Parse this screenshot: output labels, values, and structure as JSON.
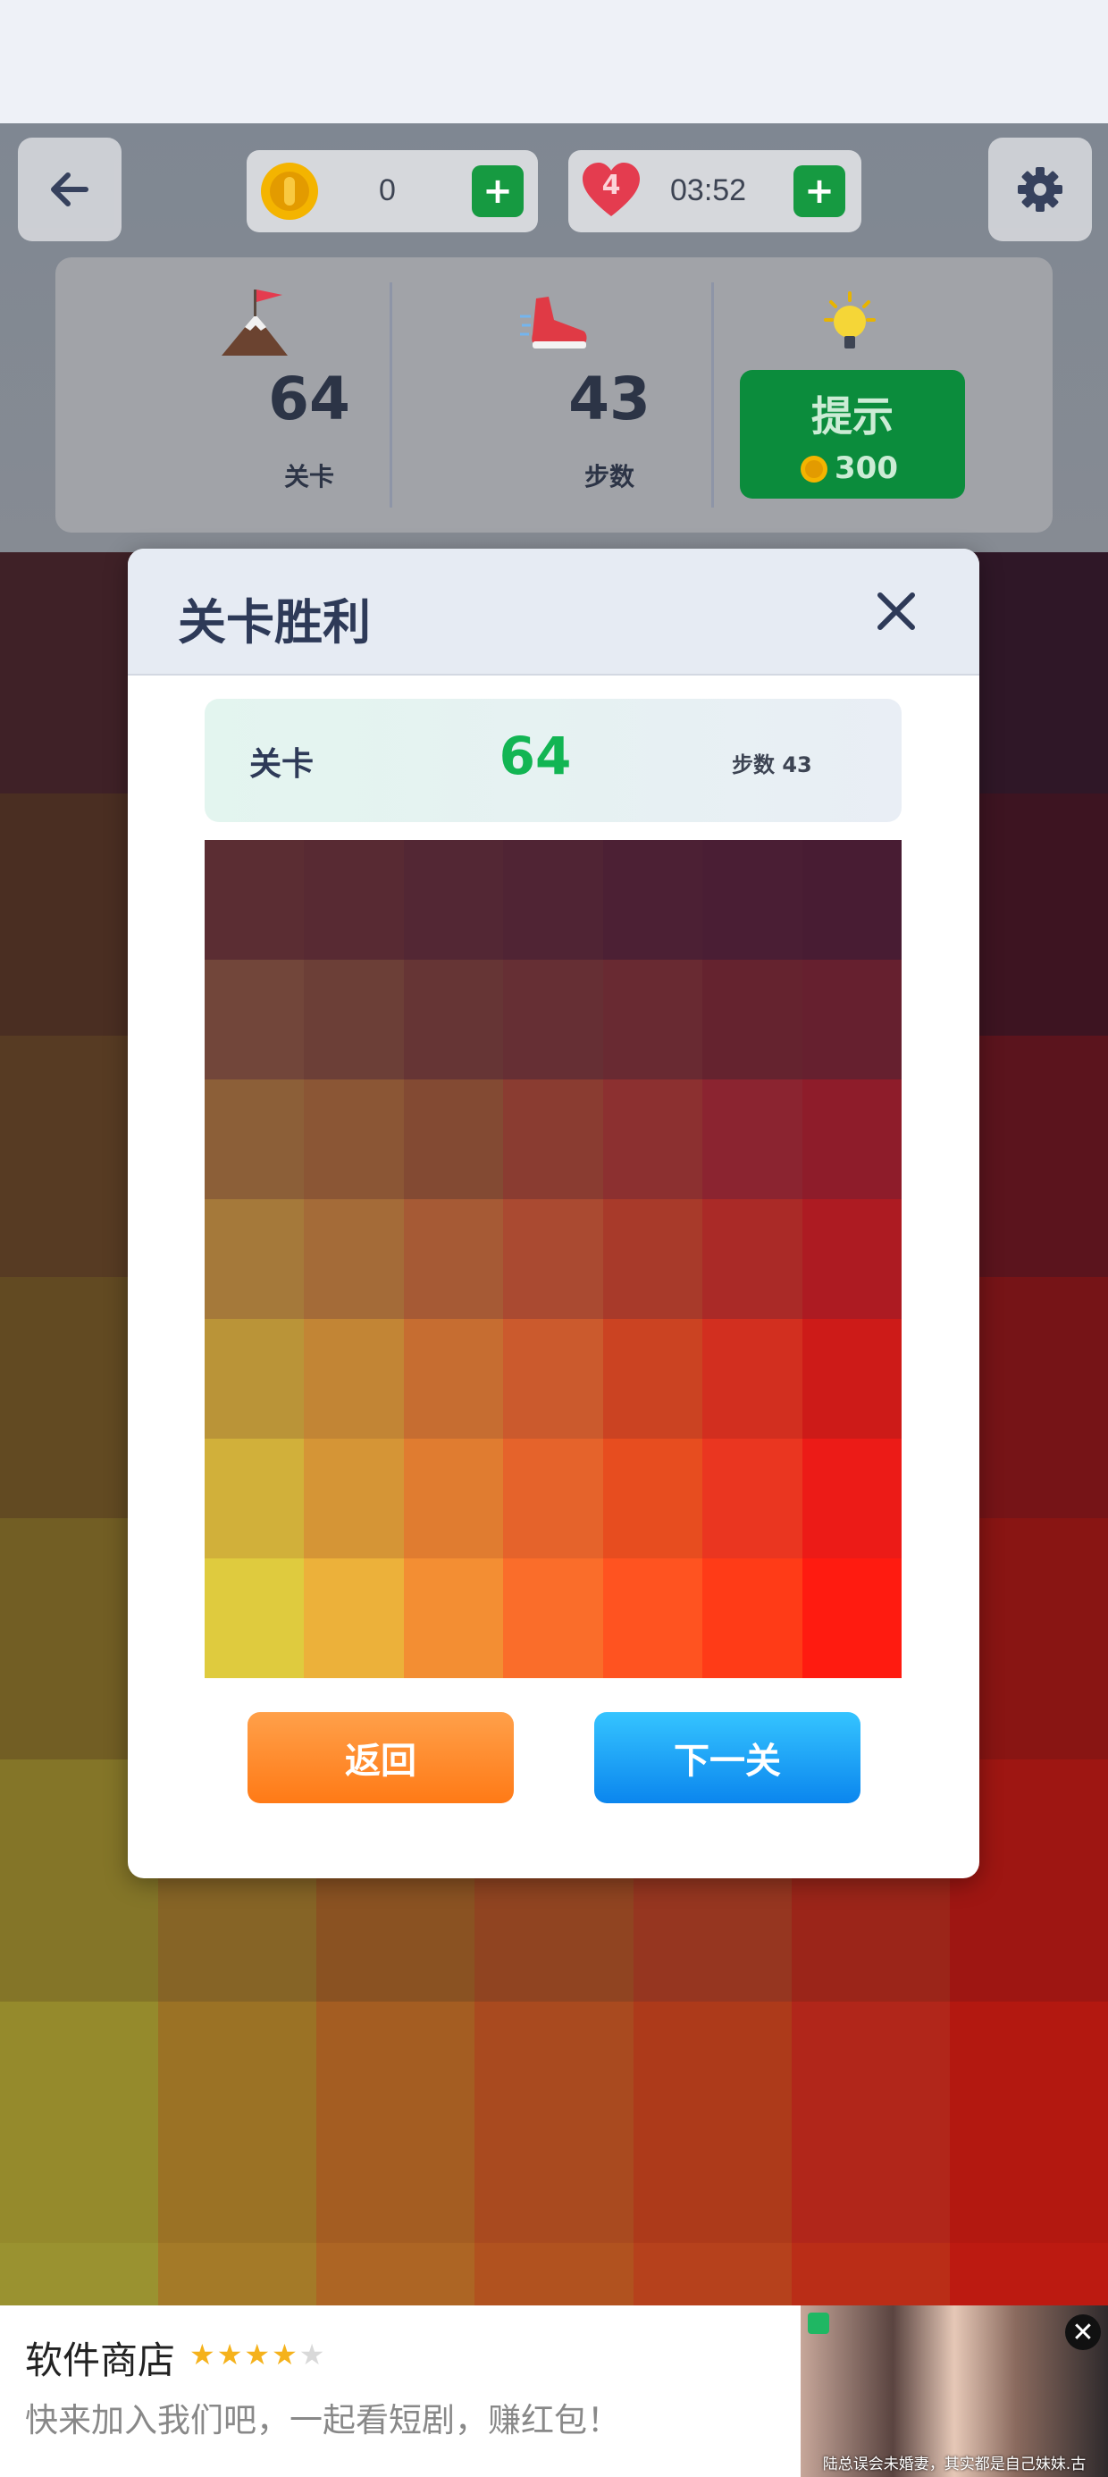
{
  "topbar": {
    "coins": "0",
    "lives": "4",
    "timer": "03:52",
    "plus": "+"
  },
  "stats": {
    "level_value": "64",
    "level_label": "关卡",
    "steps_value": "43",
    "steps_label": "步数",
    "hint_label": "提示",
    "hint_cost": "300"
  },
  "dialog": {
    "title": "关卡胜利",
    "banner_label": "关卡",
    "banner_level": "64",
    "banner_steps": "步数 43",
    "back_label": "返回",
    "next_label": "下一关"
  },
  "result_grid_colors": [
    [
      "#5b2d33",
      "#582a33",
      "#532734",
      "#502434",
      "#4c2034",
      "#4a1e34",
      "#481c33"
    ],
    [
      "#72463a",
      "#6c3f37",
      "#663535",
      "#662f34",
      "#692a32",
      "#65232f",
      "#66202f"
    ],
    [
      "#8c5f38",
      "#8b5635",
      "#834a33",
      "#8a3c31",
      "#8c3030",
      "#8b2430",
      "#8e1c2a"
    ],
    [
      "#a5793a",
      "#a46b38",
      "#a65a35",
      "#aa4a31",
      "#a83a2a",
      "#aa2a27",
      "#ad1b22"
    ],
    [
      "#ba9438",
      "#c28535",
      "#c66d31",
      "#cb5a2d",
      "#cb4322",
      "#d22f1f",
      "#cd1b18"
    ],
    [
      "#d1b03a",
      "#d59536",
      "#e07c30",
      "#e5632b",
      "#e74d1f",
      "#ea3620",
      "#ec1b17"
    ],
    [
      "#dfcb3e",
      "#ecb13a",
      "#f38e33",
      "#fa6d2a",
      "#ff5320",
      "#ff3b17",
      "#ff1b10"
    ]
  ],
  "board_colors": [
    [
      "#3f2127",
      "#3a1f26",
      "#371d27",
      "#341b28",
      "#311a29",
      "#301928",
      "#2f1727"
    ],
    [
      "#4a2e22",
      "#472a22",
      "#422624",
      "#3d2125",
      "#3e1d25",
      "#3e1724",
      "#3d1421"
    ],
    [
      "#573b23",
      "#533523",
      "#4f2d23",
      "#5a2a24",
      "#5d2523",
      "#5c1c21",
      "#5b141d"
    ],
    [
      "#624a22",
      "#5f3f22",
      "#5e3621",
      "#663122",
      "#6e2a21",
      "#741d1b",
      "#761417"
    ],
    [
      "#725e24",
      "#6e5022",
      "#6e4321",
      "#773a21",
      "#7f2e1f",
      "#851f19",
      "#891513"
    ],
    [
      "#847528",
      "#866426",
      "#8a5222",
      "#904421",
      "#963620",
      "#9b2519",
      "#9e1612"
    ],
    [
      "#958a2c",
      "#9b7225",
      "#a45d22",
      "#a94a1f",
      "#ad3a1a",
      "#b1261a",
      "#b31810"
    ],
    [
      "#9a9230",
      "#a47a28",
      "#ad6524",
      "#b1521f",
      "#b6411c",
      "#ba2d17",
      "#bc1a11"
    ]
  ],
  "ad": {
    "app_name": "软件商店",
    "stars": "★★★★★",
    "description": "快来加入我们吧，一起看短剧，赚红包！",
    "caption": "陆总误会未婚妻，其实都是自己妹妹.古",
    "close": "✕"
  },
  "colors": {
    "green_button": "#169a41",
    "hint_green": "#0b8c3c",
    "accent_orange": "#ff7a16",
    "accent_blue": "#0b86ee",
    "level_green": "#12b553",
    "title_navy": "#2e3a58"
  }
}
